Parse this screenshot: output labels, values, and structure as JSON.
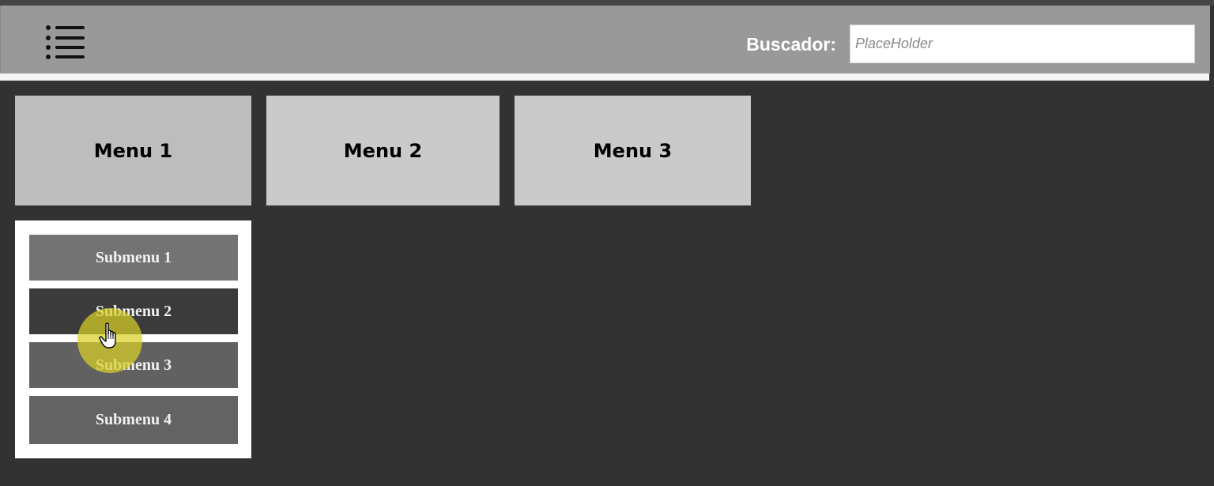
{
  "header": {
    "menu_icon": "hamburger-list-icon",
    "search_label": "Buscador:",
    "search_placeholder": "PlaceHolder",
    "search_value": ""
  },
  "menus": [
    {
      "label": "Menu 1"
    },
    {
      "label": "Menu 2"
    },
    {
      "label": "Menu 3"
    }
  ],
  "submenus": [
    {
      "label": "Submenu 1"
    },
    {
      "label": "Submenu 2"
    },
    {
      "label": "Submenu 3"
    },
    {
      "label": "Submenu 4"
    }
  ],
  "colors": {
    "background": "#323232",
    "header": "#999999",
    "menu": "#cacaca",
    "submenu": "#737373",
    "submenu_hover": "#3b3b3b",
    "cursor_highlight": "#d8d028"
  },
  "cursor": {
    "icon": "hand-pointer-icon",
    "hovering": "Submenu 2"
  }
}
